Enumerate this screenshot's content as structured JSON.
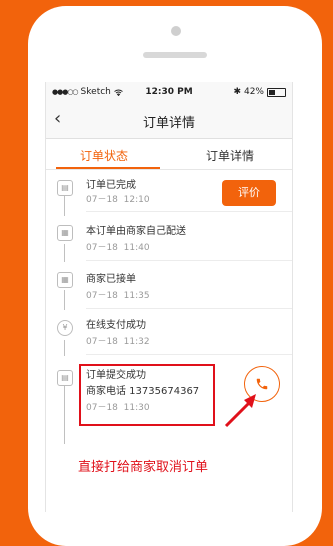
{
  "status_bar": {
    "carrier": "Sketch",
    "time": "12:30 PM",
    "battery": "42%"
  },
  "nav": {
    "back_icon": "chevron-left-icon",
    "title": "订单详情"
  },
  "tabs": [
    {
      "label": "订单状态",
      "active": true
    },
    {
      "label": "订单详情",
      "active": false
    }
  ],
  "timeline": [
    {
      "title": "订单已完成",
      "date": "07－18",
      "time": "12:10",
      "icon": "clipboard-icon"
    },
    {
      "title": "本订单由商家自己配送",
      "date": "07－18",
      "time": "11:40",
      "icon": "store-icon"
    },
    {
      "title": "商家已接单",
      "date": "07－18",
      "time": "11:35",
      "icon": "store-icon"
    },
    {
      "title": "在线支付成功",
      "date": "07－18",
      "time": "11:32",
      "icon": "yen-icon"
    },
    {
      "title": "订单提交成功",
      "phone_label": "商家电话 13735674367",
      "date": "07－18",
      "time": "11:30",
      "icon": "clipboard-icon"
    }
  ],
  "actions": {
    "evaluate_label": "评价",
    "call_icon": "phone-icon"
  },
  "annotation": {
    "note": "直接打给商家取消订单",
    "highlight_color": "#e0101a"
  },
  "colors": {
    "accent": "#f2630c",
    "annotation_red": "#e0101a"
  }
}
